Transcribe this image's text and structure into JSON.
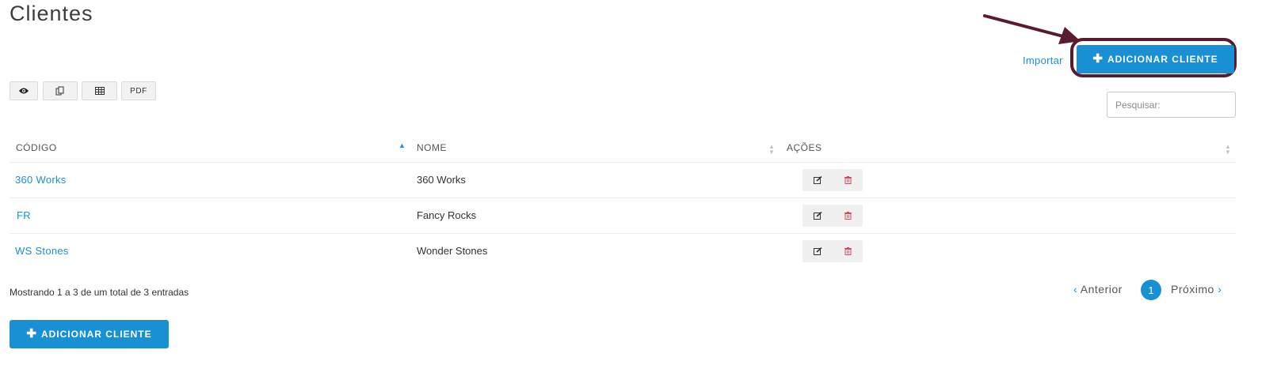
{
  "page": {
    "title": "Clientes"
  },
  "header": {
    "import_label": "Importar",
    "add_client_label": "ADICIONAR CLIENTE",
    "add_icon": "plus-icon"
  },
  "toolbar": {
    "buttons": [
      {
        "icon": "eye-icon"
      },
      {
        "icon": "copy-icon"
      },
      {
        "icon": "table-icon"
      },
      {
        "label": "PDF"
      }
    ]
  },
  "search": {
    "placeholder": "Pesquisar:",
    "value": ""
  },
  "table": {
    "columns": [
      "CÓDIGO",
      "NOME",
      "AÇÕES"
    ],
    "sort": {
      "column": "CÓDIGO",
      "direction": "asc"
    },
    "rows": [
      {
        "code": "360 Works",
        "name": "360 Works"
      },
      {
        "code": "FR",
        "name": "Fancy Rocks"
      },
      {
        "code": "WS Stones",
        "name": "Wonder Stones"
      }
    ],
    "row_actions": [
      "edit-icon",
      "trash-icon"
    ]
  },
  "footer": {
    "info": "Mostrando 1 a 3 de um total de 3 entradas",
    "pagination": {
      "prev": "Anterior",
      "current": "1",
      "next": "Próximo"
    },
    "add_client_label": "ADICIONAR CLIENTE"
  },
  "colors": {
    "accent": "#1a90d4",
    "annotation": "#5a1a30",
    "delete": "#e0445b"
  }
}
